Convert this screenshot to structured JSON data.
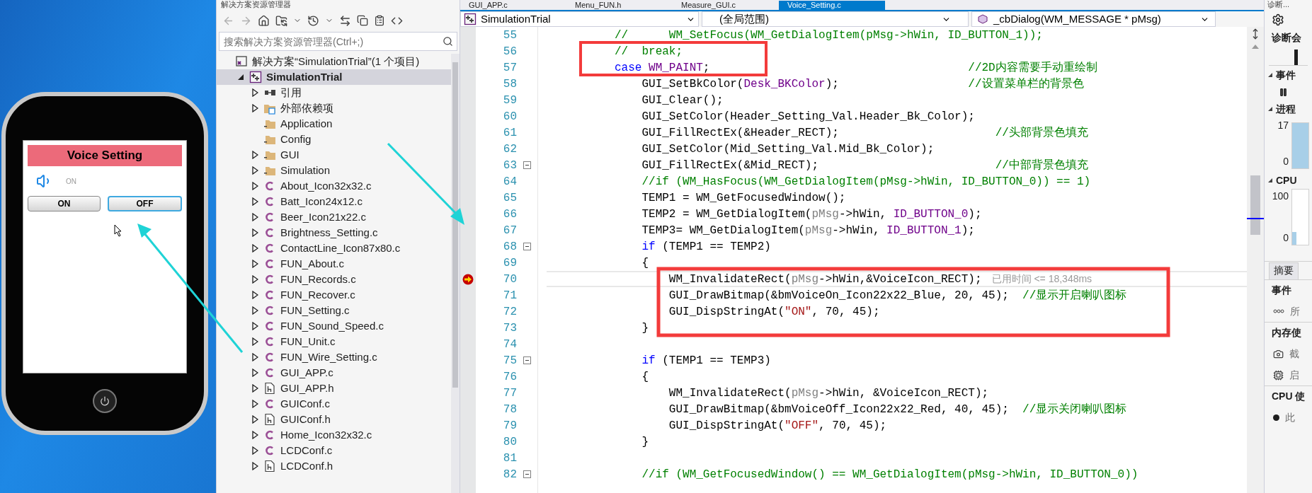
{
  "phone": {
    "header": "Voice Setting",
    "status_label": "ON",
    "buttons": [
      {
        "label": "ON",
        "selected": false
      },
      {
        "label": "OFF",
        "selected": true
      }
    ]
  },
  "explorer": {
    "title": "解决方案资源管理器",
    "search": {
      "placeholder": "搜索解决方案资源管理器(Ctrl+;)"
    },
    "tree": [
      {
        "label": "解决方案“SimulationTrial”(1 个项目)",
        "kind": "solution",
        "selected": false,
        "children": [
          {
            "label": "SimulationTrial",
            "kind": "project",
            "expanded": true,
            "selected": true,
            "children": [
              {
                "label": "引用",
                "kind": "references",
                "expanded": false,
                "selected": false
              },
              {
                "label": "外部依赖项",
                "kind": "external",
                "expanded": false,
                "selected": false
              },
              {
                "label": "Application",
                "kind": "folder",
                "selected": false
              },
              {
                "label": "Config",
                "kind": "folder",
                "selected": false
              },
              {
                "label": "GUI",
                "kind": "folder",
                "expanded": false,
                "selected": false
              },
              {
                "label": "Simulation",
                "kind": "folder",
                "expanded": false,
                "selected": false
              },
              {
                "label": "About_Icon32x32.c",
                "kind": "c-file",
                "expanded": false,
                "selected": false
              },
              {
                "label": "Batt_Icon24x12.c",
                "kind": "c-file",
                "expanded": false,
                "selected": false
              },
              {
                "label": "Beer_Icon21x22.c",
                "kind": "c-file",
                "expanded": false,
                "selected": false
              },
              {
                "label": "Brightness_Setting.c",
                "kind": "c-file",
                "expanded": false,
                "selected": false
              },
              {
                "label": "ContactLine_Icon87x80.c",
                "kind": "c-file",
                "expanded": false,
                "selected": false
              },
              {
                "label": "FUN_About.c",
                "kind": "c-file",
                "expanded": false,
                "selected": false
              },
              {
                "label": "FUN_Records.c",
                "kind": "c-file",
                "expanded": false,
                "selected": false
              },
              {
                "label": "FUN_Recover.c",
                "kind": "c-file",
                "expanded": false,
                "selected": false
              },
              {
                "label": "FUN_Setting.c",
                "kind": "c-file",
                "expanded": false,
                "selected": false
              },
              {
                "label": "FUN_Sound_Speed.c",
                "kind": "c-file",
                "expanded": false,
                "selected": false
              },
              {
                "label": "FUN_Unit.c",
                "kind": "c-file",
                "expanded": false,
                "selected": false
              },
              {
                "label": "FUN_Wire_Setting.c",
                "kind": "c-file",
                "expanded": false,
                "selected": false
              },
              {
                "label": "GUI_APP.c",
                "kind": "c-file",
                "expanded": false,
                "selected": false
              },
              {
                "label": "GUI_APP.h",
                "kind": "h-file",
                "expanded": false,
                "selected": false
              },
              {
                "label": "GUIConf.c",
                "kind": "c-file",
                "expanded": false,
                "selected": false
              },
              {
                "label": "GUIConf.h",
                "kind": "h-file",
                "expanded": false,
                "selected": false
              },
              {
                "label": "Home_Icon32x32.c",
                "kind": "c-file",
                "expanded": false,
                "selected": false
              },
              {
                "label": "LCDConf.c",
                "kind": "c-file",
                "expanded": false,
                "selected": false
              },
              {
                "label": "LCDConf.h",
                "kind": "h-file",
                "expanded": false,
                "selected": false
              }
            ]
          }
        ]
      }
    ]
  },
  "code_tabs": [
    {
      "label": "GUI_APP.c",
      "selected": false
    },
    {
      "label": "Menu_FUN.h",
      "selected": false
    },
    {
      "label": "Measure_GUI.c",
      "selected": false
    },
    {
      "label": "Voice_Setting.c",
      "selected": true
    }
  ],
  "nav_bar": {
    "project": "SimulationTrial",
    "scope": "(全局范围)",
    "member": "_cbDialog(WM_MESSAGE * pMsg)"
  },
  "code_lines": [
    {
      "number": "55",
      "tokens": [
        {
          "kind": "comment",
          "text": "          //      WM_SetFocus(WM_GetDialogItem(pMsg->hWin, ID_BUTTON_1));"
        }
      ]
    },
    {
      "number": "56",
      "tokens": [
        {
          "kind": "comment",
          "text": "          //  break;"
        }
      ]
    },
    {
      "number": "57",
      "tokens": [
        {
          "kind": "keyword",
          "text": "          case "
        },
        {
          "kind": "macro",
          "text": "WM_PAINT"
        },
        {
          "kind": "plain",
          "text": ";                                      "
        },
        {
          "kind": "comment",
          "text": "//2D内容需要手动重绘制"
        }
      ]
    },
    {
      "number": "58",
      "tokens": [
        {
          "kind": "plain",
          "text": "              GUI_SetBkColor("
        },
        {
          "kind": "macro",
          "text": "Desk_BKColor"
        },
        {
          "kind": "plain",
          "text": ");                   "
        },
        {
          "kind": "comment",
          "text": "//设置菜单栏的背景色"
        }
      ]
    },
    {
      "number": "59",
      "tokens": [
        {
          "kind": "plain",
          "text": "              GUI_Clear();"
        }
      ]
    },
    {
      "number": "60",
      "tokens": [
        {
          "kind": "plain",
          "text": "              GUI_SetColor(Header_Setting_Val.Header_Bk_Color);"
        }
      ]
    },
    {
      "number": "61",
      "tokens": [
        {
          "kind": "plain",
          "text": "              GUI_FillRectEx(&Header_RECT);                       "
        },
        {
          "kind": "comment",
          "text": "//头部背景色填充"
        }
      ]
    },
    {
      "number": "62",
      "tokens": [
        {
          "kind": "plain",
          "text": "              GUI_SetColor(Mid_Setting_Val.Mid_Bk_Color);"
        }
      ]
    },
    {
      "number": "63",
      "fold_expanded": true,
      "tokens": [
        {
          "kind": "plain",
          "text": "              GUI_FillRectEx(&Mid_RECT);                          "
        },
        {
          "kind": "comment",
          "text": "//中部背景色填充"
        }
      ]
    },
    {
      "number": "64",
      "tokens": [
        {
          "kind": "comment",
          "text": "              //if (WM_HasFocus(WM_GetDialogItem(pMsg->hWin, ID_BUTTON_0)) == 1)"
        }
      ]
    },
    {
      "number": "65",
      "tokens": [
        {
          "kind": "plain",
          "text": "              TEMP1 = WM_GetFocusedWindow();"
        }
      ]
    },
    {
      "number": "66",
      "tokens": [
        {
          "kind": "plain",
          "text": "              TEMP2 = WM_GetDialogItem("
        },
        {
          "kind": "param",
          "text": "pMsg"
        },
        {
          "kind": "plain",
          "text": "->hWin, "
        },
        {
          "kind": "macro",
          "text": "ID_BUTTON_0"
        },
        {
          "kind": "plain",
          "text": ");"
        }
      ]
    },
    {
      "number": "67",
      "tokens": [
        {
          "kind": "plain",
          "text": "              TEMP3= WM_GetDialogItem("
        },
        {
          "kind": "param",
          "text": "pMsg"
        },
        {
          "kind": "plain",
          "text": "->hWin, "
        },
        {
          "kind": "macro",
          "text": "ID_BUTTON_1"
        },
        {
          "kind": "plain",
          "text": ");"
        }
      ]
    },
    {
      "number": "68",
      "fold_expanded": true,
      "tokens": [
        {
          "kind": "keyword",
          "text": "              if"
        },
        {
          "kind": "plain",
          "text": " (TEMP1 == TEMP2)"
        }
      ]
    },
    {
      "number": "69",
      "tokens": [
        {
          "kind": "plain",
          "text": "              {"
        }
      ]
    },
    {
      "number": "70",
      "current": true,
      "hint": "已用时间 <= 18,348ms",
      "tokens": [
        {
          "kind": "plain",
          "text": "                  WM_InvalidateRect("
        },
        {
          "kind": "param",
          "text": "pMsg"
        },
        {
          "kind": "plain",
          "text": "->hWin,&VoiceIcon_RECT);"
        }
      ]
    },
    {
      "number": "71",
      "tokens": [
        {
          "kind": "plain",
          "text": "                  GUI_DrawBitmap(&bmVoiceOn_Icon22x22_Blue, 20, 45);  "
        },
        {
          "kind": "comment",
          "text": "//显示开启喇叭图标"
        }
      ]
    },
    {
      "number": "72",
      "tokens": [
        {
          "kind": "plain",
          "text": "                  GUI_DispStringAt("
        },
        {
          "kind": "string",
          "text": "\"ON\""
        },
        {
          "kind": "plain",
          "text": ", 70, 45);"
        }
      ]
    },
    {
      "number": "73",
      "tokens": [
        {
          "kind": "plain",
          "text": "              }"
        }
      ]
    },
    {
      "number": "74"
    },
    {
      "number": "75",
      "fold_expanded": true,
      "tokens": [
        {
          "kind": "keyword",
          "text": "              if"
        },
        {
          "kind": "plain",
          "text": " (TEMP1 == TEMP3)"
        }
      ]
    },
    {
      "number": "76",
      "tokens": [
        {
          "kind": "plain",
          "text": "              {"
        }
      ]
    },
    {
      "number": "77",
      "tokens": [
        {
          "kind": "plain",
          "text": "                  WM_InvalidateRect("
        },
        {
          "kind": "param",
          "text": "pMsg"
        },
        {
          "kind": "plain",
          "text": "->hWin, &VoiceIcon_RECT);"
        }
      ]
    },
    {
      "number": "78",
      "tokens": [
        {
          "kind": "plain",
          "text": "                  GUI_DrawBitmap(&bmVoiceOff_Icon22x22_Red, 40, 45);  "
        },
        {
          "kind": "comment",
          "text": "//显示关闭喇叭图标"
        }
      ]
    },
    {
      "number": "79",
      "tokens": [
        {
          "kind": "plain",
          "text": "                  GUI_DispStringAt("
        },
        {
          "kind": "string",
          "text": "\"OFF\""
        },
        {
          "kind": "plain",
          "text": ", 70, 45);"
        }
      ]
    },
    {
      "number": "80",
      "tokens": [
        {
          "kind": "plain",
          "text": "              }"
        }
      ]
    },
    {
      "number": "81"
    },
    {
      "number": "82",
      "fold_expanded": true,
      "tokens": [
        {
          "kind": "comment",
          "text": "              //if (WM_GetFocusedWindow() == WM_GetDialogItem(pMsg->hWin, ID_BUTTON_0))"
        }
      ]
    }
  ],
  "diagnostics": {
    "title": "诊断...",
    "session": "诊断会",
    "events_header": "事件",
    "process_header": "进程",
    "process_max": "17",
    "process_min": "0",
    "cpu_header": "CPU",
    "cpu_max": "100",
    "cpu_min": "0",
    "tabs": [
      {
        "label": "摘要",
        "selected": true
      }
    ],
    "summary": [
      {
        "kind": "heading",
        "text": "事件"
      },
      {
        "kind": "events",
        "text": "所"
      },
      {
        "kind": "heading",
        "text": "内存使"
      },
      {
        "kind": "snapshot",
        "text": "截"
      },
      {
        "kind": "heap",
        "text": "启"
      },
      {
        "kind": "heading",
        "text": "CPU 使"
      },
      {
        "kind": "record",
        "text": "此"
      }
    ]
  }
}
